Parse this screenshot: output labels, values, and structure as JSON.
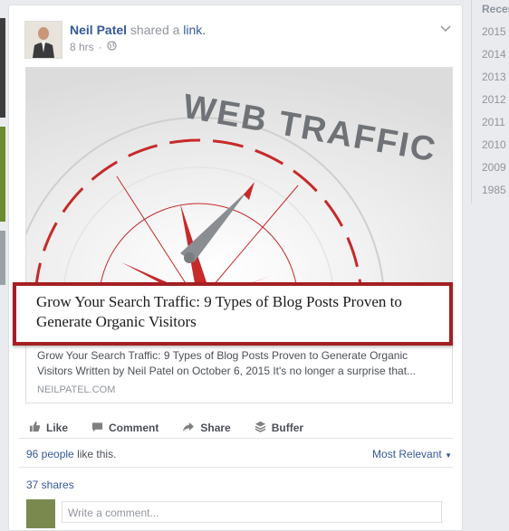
{
  "post": {
    "author": "Neil Patel",
    "action_text": "shared a",
    "link_word": "link.",
    "time": "8 hrs",
    "privacy_icon": "globe-icon",
    "menu_icon": "chevron-down-icon"
  },
  "attachment": {
    "image_text": "WEB TRAFFIC",
    "title": "Grow Your Search Traffic: 9 Types of Blog Posts Proven to Generate Organic Visitors",
    "description": "Grow Your Search Traffic: 9 Types of Blog Posts Proven to Generate Organic Visitors Written by Neil Patel on October 6, 2015 It's no longer a surprise that...",
    "domain": "NEILPATEL.COM"
  },
  "actions": {
    "like": "Like",
    "comment": "Comment",
    "share": "Share",
    "buffer": "Buffer"
  },
  "reactions": {
    "count": "96 people",
    "suffix": "like this.",
    "sort": "Most Relevant"
  },
  "shares": "37 shares",
  "comment_box": {
    "placeholder": "Write a comment..."
  },
  "timeline_years": [
    "Recent",
    "2015",
    "2014",
    "2013",
    "2012",
    "2011",
    "2010",
    "2009",
    "1985"
  ],
  "colors": {
    "link": "#365899",
    "highlight_border": "#a41f22",
    "muted": "#90949c"
  }
}
